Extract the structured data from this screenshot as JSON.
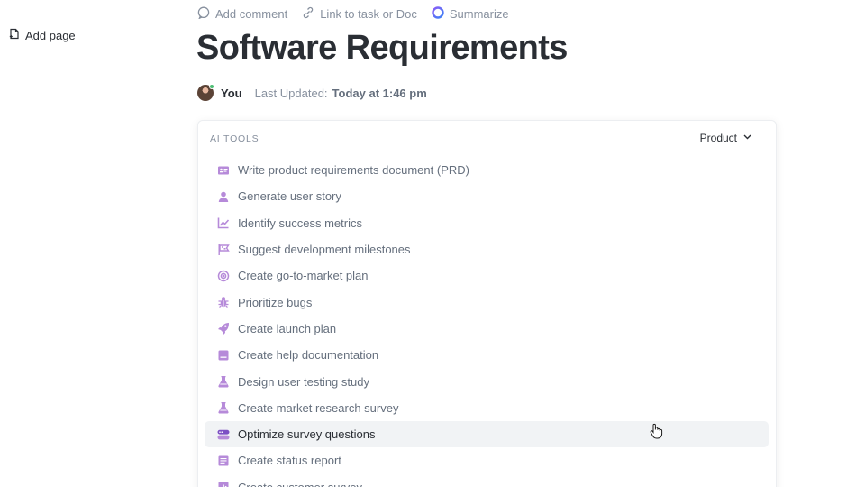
{
  "sidebar": {
    "add_page_label": "Add page"
  },
  "toolbar": {
    "add_comment_label": "Add comment",
    "link_label": "Link to task or Doc",
    "summarize_label": "Summarize"
  },
  "doc": {
    "title": "Software Requirements",
    "author": "You",
    "last_updated_label": "Last Updated:",
    "last_updated_value": "Today at 1:46 pm"
  },
  "ai_tools": {
    "section_label": "AI TOOLS",
    "category": "Product",
    "accent_color": "#b68ad9",
    "items": [
      {
        "label": "Write product requirements document (PRD)",
        "icon": "id-card-icon"
      },
      {
        "label": "Generate user story",
        "icon": "user-icon"
      },
      {
        "label": "Identify success metrics",
        "icon": "chart-line-icon"
      },
      {
        "label": "Suggest development milestones",
        "icon": "flag-icon"
      },
      {
        "label": "Create go-to-market plan",
        "icon": "target-icon"
      },
      {
        "label": "Prioritize bugs",
        "icon": "bug-icon"
      },
      {
        "label": "Create launch plan",
        "icon": "rocket-icon"
      },
      {
        "label": "Create help documentation",
        "icon": "document-icon"
      },
      {
        "label": "Design user testing study",
        "icon": "flask-icon"
      },
      {
        "label": "Create market research survey",
        "icon": "flask-icon"
      },
      {
        "label": "Optimize survey questions",
        "icon": "chat-bubbles-icon",
        "highlighted": true
      },
      {
        "label": "Create status report",
        "icon": "report-icon"
      },
      {
        "label": "Create customer survey",
        "icon": "chart-bar-icon"
      }
    ]
  }
}
